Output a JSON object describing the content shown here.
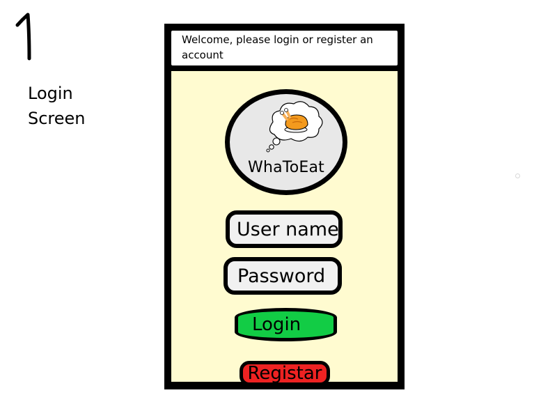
{
  "annotation": {
    "screen_number": "1",
    "screen_label": "Login\nScreen"
  },
  "welcome_bar": {
    "message": "Welcome, please login or register an account"
  },
  "logo": {
    "text": "WhaToEat",
    "image": "roast-chicken-thought-bubble-icon"
  },
  "login_form": {
    "username_placeholder": "User name",
    "password_placeholder": "Password",
    "login_label": "Login",
    "register_label": "Registar"
  },
  "colors": {
    "frame": "#000000",
    "content_background": "#fffbd0",
    "logo_background": "#e8e8e8",
    "field_background": "#f1f1f1",
    "login_button": "#12cc45",
    "register_button": "#ee2222"
  }
}
